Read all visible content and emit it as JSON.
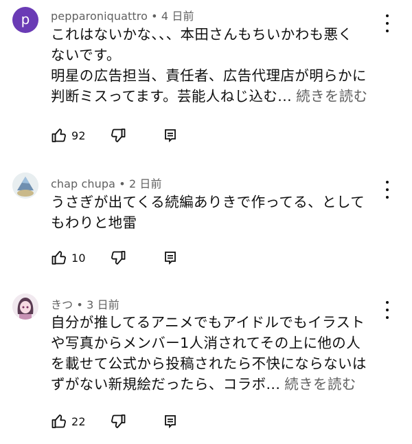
{
  "comments": [
    {
      "author": "pepparoniquattro",
      "time": "4 日前",
      "avatar_letter": "p",
      "avatar_color": "#6a3bb5",
      "lines": [
        "これはないかな、、、本田さんもちいかわも悪く",
        "ないです。",
        "明星の広告担当、責任者、広告代理店が明らかに",
        "判断ミスってます。芸能人ねじ込む..."
      ],
      "more_label": "続きを読む",
      "like_count": "92"
    },
    {
      "author": "chap chupa",
      "time": "2 日前",
      "lines": [
        "うさぎが出てくる続編ありきで作ってる、として",
        "もわりと地雷"
      ],
      "like_count": "10"
    },
    {
      "author": "きつ",
      "time": "3 日前",
      "lines": [
        "自分が推してるアニメでもアイドルでもイラスト",
        "や写真からメンバー1人消されてその上に他の人",
        "を載せて公式から投稿されたら不快にならないは",
        "ずがない新規絵だったら、コラボ..."
      ],
      "more_label": "続きを読む",
      "like_count": "22"
    }
  ],
  "separator": " • ",
  "icons": {
    "like": "thumbs-up-icon",
    "dislike": "thumbs-down-icon",
    "reply": "reply-icon",
    "menu": "more-vert-icon"
  }
}
